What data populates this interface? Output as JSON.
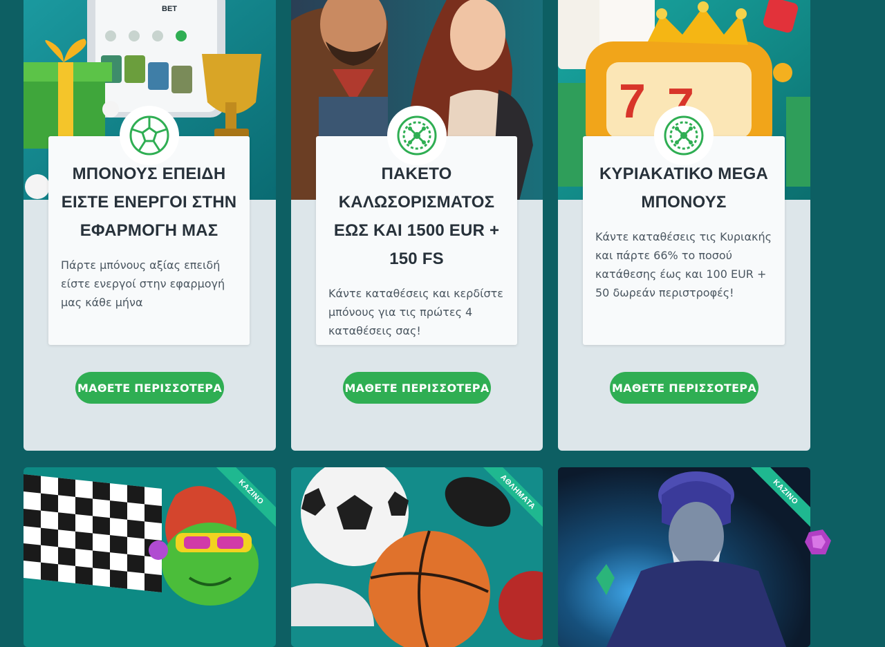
{
  "promos": [
    {
      "title": "ΜΠΟΝΟΥΣ ΕΠΕΙΔΗ ΕΙΣΤΕ ΕΝΕΡΓΟΙ ΣΤΗΝ ΕΦΑΡΜΟΓΗ ΜΑΣ",
      "description": "Πάρτε μπόνους αξίας επειδή είστε ενεργοί στην εφαρμογή μας κάθε μήνα",
      "button_label": "ΜΑΘΕΤΕ ΠΕΡΙΣΣΟΤΕΡΑ",
      "icon": "soccer-ball-icon",
      "image_label": "BET"
    },
    {
      "title": "ΠΑΚΕΤΟ ΚΑΛΩΣΟΡΙΣΜΑΤΟΣ ΕΩΣ ΚΑΙ 1500 EUR + 150 FS",
      "description": "Κάντε καταθέσεις και κερδίστε μπόνους για τις πρώτες 4 καταθέσεις σας!",
      "button_label": "ΜΑΘΕΤΕ ΠΕΡΙΣΣΟΤΕΡΑ",
      "icon": "roulette-icon"
    },
    {
      "title": "ΚΥΡΙΑΚΑΤΙΚΟ MEGA ΜΠΟΝΟΥΣ",
      "description": "Κάντε καταθέσεις τις Κυριακής και πάρτε 66% το ποσού κατάθεσης έως και 100 EUR + 50 δωρεάν περιστροφές!",
      "button_label": "ΜΑΘΕΤΕ ΠΕΡΙΣΣΟΤΕΡΑ",
      "icon": "roulette-icon"
    }
  ],
  "bottom_cards": [
    {
      "ribbon": "ΚΑΖΙΝΟ"
    },
    {
      "ribbon": "ΑΘΛΗΜΑΤΑ"
    },
    {
      "ribbon": "ΚΑΖΙΝΟ"
    }
  ],
  "colors": {
    "page_bg": "#0d5f63",
    "card_bg": "#dde6ea",
    "button": "#2fae53",
    "icon": "#2fae53",
    "ribbon": "#1fb890",
    "title_text": "#27313a"
  }
}
